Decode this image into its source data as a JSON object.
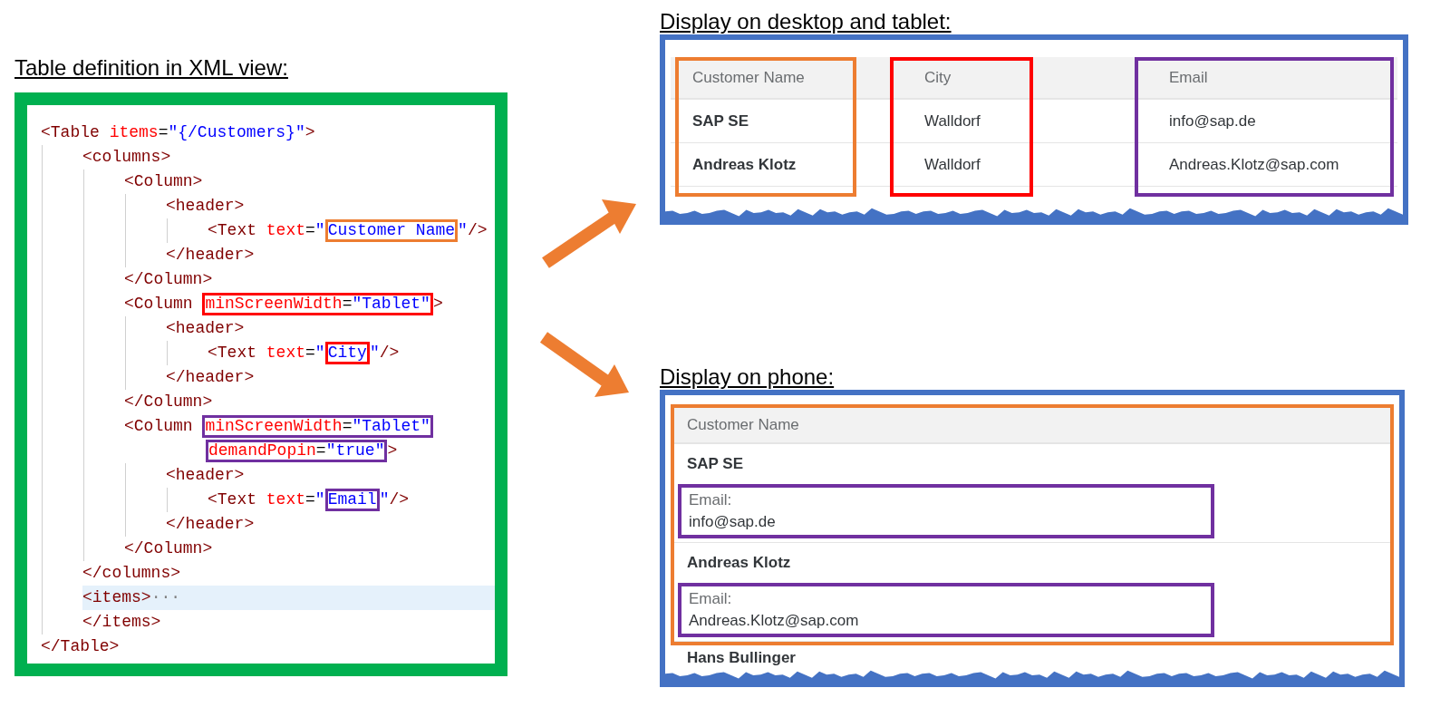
{
  "code_panel": {
    "title": "Table definition in XML view:",
    "root": {
      "open": [
        {
          "selected": false,
          "parts": [
            {
              "kind": "tag",
              "text": "<Table "
            },
            {
              "kind": "attr",
              "text": "items"
            },
            {
              "kind": "eq",
              "text": "="
            },
            {
              "kind": "str",
              "text": "\"{/Customers}\""
            },
            {
              "kind": "tag",
              "text": ">"
            }
          ]
        }
      ],
      "children": [
        {
          "open": [
            {
              "selected": false,
              "parts": [
                {
                  "kind": "tag",
                  "text": "<columns>"
                }
              ]
            }
          ],
          "children": [
            {
              "open": [
                {
                  "selected": false,
                  "parts": [
                    {
                      "kind": "tag",
                      "text": "<Column>"
                    }
                  ]
                }
              ],
              "children": [
                {
                  "open": [
                    {
                      "selected": false,
                      "parts": [
                        {
                          "kind": "tag",
                          "text": "<header>"
                        }
                      ]
                    }
                  ],
                  "children": [
                    {
                      "open": [
                        {
                          "selected": false,
                          "parts": [
                            {
                              "kind": "tag",
                              "text": "<Text "
                            },
                            {
                              "kind": "attr",
                              "text": "text"
                            },
                            {
                              "kind": "eq",
                              "text": "="
                            },
                            {
                              "kind": "str",
                              "text": "\""
                            },
                            {
                              "kind": "box",
                              "color": "#ed7d31",
                              "parts": [
                                {
                                  "kind": "str",
                                  "text": "Customer Name"
                                }
                              ]
                            },
                            {
                              "kind": "str",
                              "text": "\""
                            },
                            {
                              "kind": "tag",
                              "text": "/>"
                            }
                          ]
                        }
                      ]
                    }
                  ],
                  "close": {
                    "selected": false,
                    "parts": [
                      {
                        "kind": "tag",
                        "text": "</header>"
                      }
                    ]
                  }
                }
              ],
              "close": {
                "selected": false,
                "parts": [
                  {
                    "kind": "tag",
                    "text": "</Column>"
                  }
                ]
              }
            },
            {
              "open": [
                {
                  "selected": false,
                  "parts": [
                    {
                      "kind": "tag",
                      "text": "<Column "
                    },
                    {
                      "kind": "box",
                      "color": "#ff0000",
                      "parts": [
                        {
                          "kind": "attr",
                          "text": "minScreenWidth"
                        },
                        {
                          "kind": "eq",
                          "text": "="
                        },
                        {
                          "kind": "str",
                          "text": "\"Tablet\""
                        }
                      ]
                    },
                    {
                      "kind": "tag",
                      "text": ">"
                    }
                  ]
                }
              ],
              "children": [
                {
                  "open": [
                    {
                      "selected": false,
                      "parts": [
                        {
                          "kind": "tag",
                          "text": "<header>"
                        }
                      ]
                    }
                  ],
                  "children": [
                    {
                      "open": [
                        {
                          "selected": false,
                          "parts": [
                            {
                              "kind": "tag",
                              "text": "<Text "
                            },
                            {
                              "kind": "attr",
                              "text": "text"
                            },
                            {
                              "kind": "eq",
                              "text": "="
                            },
                            {
                              "kind": "str",
                              "text": "\""
                            },
                            {
                              "kind": "box",
                              "color": "#ff0000",
                              "parts": [
                                {
                                  "kind": "str",
                                  "text": "City"
                                }
                              ]
                            },
                            {
                              "kind": "str",
                              "text": "\""
                            },
                            {
                              "kind": "tag",
                              "text": "/>"
                            }
                          ]
                        }
                      ]
                    }
                  ],
                  "close": {
                    "selected": false,
                    "parts": [
                      {
                        "kind": "tag",
                        "text": "</header>"
                      }
                    ]
                  }
                }
              ],
              "close": {
                "selected": false,
                "parts": [
                  {
                    "kind": "tag",
                    "text": "</Column>"
                  }
                ]
              }
            },
            {
              "open": [
                {
                  "selected": false,
                  "parts": [
                    {
                      "kind": "tag",
                      "text": "<Column "
                    },
                    {
                      "kind": "box",
                      "color": "#7030a0",
                      "parts": [
                        {
                          "kind": "attr",
                          "text": "minScreenWidth"
                        },
                        {
                          "kind": "eq",
                          "text": "="
                        },
                        {
                          "kind": "str",
                          "text": "\"Tablet\""
                        }
                      ]
                    }
                  ]
                },
                {
                  "selected": false,
                  "parts": [
                    {
                      "kind": "box",
                      "color": "#7030a0",
                      "parts": [
                        {
                          "kind": "attr",
                          "text": "demandPopin"
                        },
                        {
                          "kind": "eq",
                          "text": "="
                        },
                        {
                          "kind": "str",
                          "text": "\"true\""
                        }
                      ]
                    },
                    {
                      "kind": "tag",
                      "text": ">"
                    }
                  ]
                }
              ],
              "children": [
                {
                  "open": [
                    {
                      "selected": false,
                      "parts": [
                        {
                          "kind": "tag",
                          "text": "<header>"
                        }
                      ]
                    }
                  ],
                  "children": [
                    {
                      "open": [
                        {
                          "selected": false,
                          "parts": [
                            {
                              "kind": "tag",
                              "text": "<Text "
                            },
                            {
                              "kind": "attr",
                              "text": "text"
                            },
                            {
                              "kind": "eq",
                              "text": "="
                            },
                            {
                              "kind": "str",
                              "text": "\""
                            },
                            {
                              "kind": "box",
                              "color": "#7030a0",
                              "parts": [
                                {
                                  "kind": "str",
                                  "text": "Email"
                                }
                              ]
                            },
                            {
                              "kind": "str",
                              "text": "\""
                            },
                            {
                              "kind": "tag",
                              "text": "/>"
                            }
                          ]
                        }
                      ]
                    }
                  ],
                  "close": {
                    "selected": false,
                    "parts": [
                      {
                        "kind": "tag",
                        "text": "</header>"
                      }
                    ]
                  }
                }
              ],
              "close": {
                "selected": false,
                "parts": [
                  {
                    "kind": "tag",
                    "text": "</Column>"
                  }
                ]
              }
            }
          ],
          "close": {
            "selected": false,
            "parts": [
              {
                "kind": "tag",
                "text": "</columns>"
              }
            ]
          }
        },
        {
          "open": [
            {
              "selected": true,
              "parts": [
                {
                  "kind": "tag",
                  "text": "<items>"
                },
                {
                  "kind": "fold",
                  "text": "···"
                }
              ]
            }
          ],
          "close": {
            "selected": false,
            "parts": [
              {
                "kind": "tag",
                "text": "</items>"
              }
            ]
          }
        }
      ],
      "close": {
        "selected": false,
        "parts": [
          {
            "kind": "tag",
            "text": "</Table>"
          }
        ]
      }
    }
  },
  "desktop": {
    "title": "Display on desktop and tablet:",
    "columns": [
      {
        "header": "Customer Name",
        "color": "#ed7d31",
        "cells": [
          "SAP SE",
          "Andreas Klotz"
        ]
      },
      {
        "header": "City",
        "color": "#ff0000",
        "cells": [
          "Walldorf",
          "Walldorf"
        ]
      },
      {
        "header": "Email",
        "color": "#7030a0",
        "cells": [
          "info@sap.de",
          "Andreas.Klotz@sap.com"
        ]
      }
    ]
  },
  "phone": {
    "title": "Display on phone:",
    "header": "Customer Name",
    "color": "#ed7d31",
    "rows": [
      {
        "name": "SAP SE",
        "popin_label": "Email:",
        "popin_value": "info@sap.de",
        "color": "#7030a0"
      },
      {
        "name": "Andreas Klotz",
        "popin_label": "Email:",
        "popin_value": "Andreas.Klotz@sap.com",
        "color": "#7030a0"
      }
    ],
    "partial_row": "Hans Bullinger"
  }
}
